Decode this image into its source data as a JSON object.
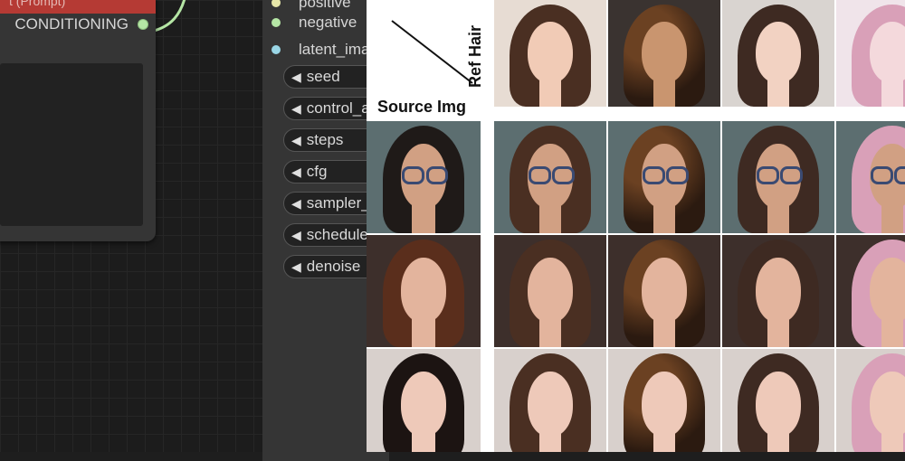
{
  "node_prompt": {
    "title_partial": "t (Prompt)",
    "output_label": "CONDITIONING",
    "title_color": "#b53a34"
  },
  "node_sampler": {
    "inputs": [
      {
        "label": "positive",
        "dot_color": "#e6e6a8"
      },
      {
        "label": "negative",
        "dot_color": "#b5e6a5"
      },
      {
        "label": "latent_image",
        "dot_color": "#9ad6e6"
      }
    ],
    "widgets": [
      "seed",
      "control_after_generate",
      "steps",
      "cfg",
      "sampler_name",
      "scheduler",
      "denoise"
    ],
    "widget_arrow": "◀"
  },
  "figure": {
    "ref_label": "Ref Hair",
    "source_label": "Source Img",
    "ref_hair_images": [
      {
        "name": "ref-hair-1",
        "hair": "#4a2f22",
        "skin": "#f1cbb6",
        "bg": "#e7dcd3",
        "style": "straight-bangs"
      },
      {
        "name": "ref-hair-2",
        "hair": "#6b4122",
        "skin": "#c9956f",
        "bg": "#3a3330",
        "style": "curly"
      },
      {
        "name": "ref-hair-3",
        "hair": "#3e2a22",
        "skin": "#f2d2c2",
        "bg": "#d9d4d0",
        "style": "bob"
      },
      {
        "name": "ref-hair-4",
        "hair": "#d9a0b8",
        "skin": "#f4d9dc",
        "bg": "#f0e4ea",
        "style": "pink"
      }
    ],
    "source_images": [
      {
        "name": "source-1",
        "hair": "#1f1a18",
        "skin": "#d1a083",
        "bg": "#5c6e70",
        "glasses": true
      },
      {
        "name": "source-2",
        "hair": "#5a2e1c",
        "skin": "#e3b49d",
        "bg": "#3d2f2b",
        "glasses": false
      },
      {
        "name": "source-3",
        "hair": "#1c1412",
        "skin": "#eec9b9",
        "bg": "#d8d0cc",
        "glasses": false
      }
    ]
  }
}
